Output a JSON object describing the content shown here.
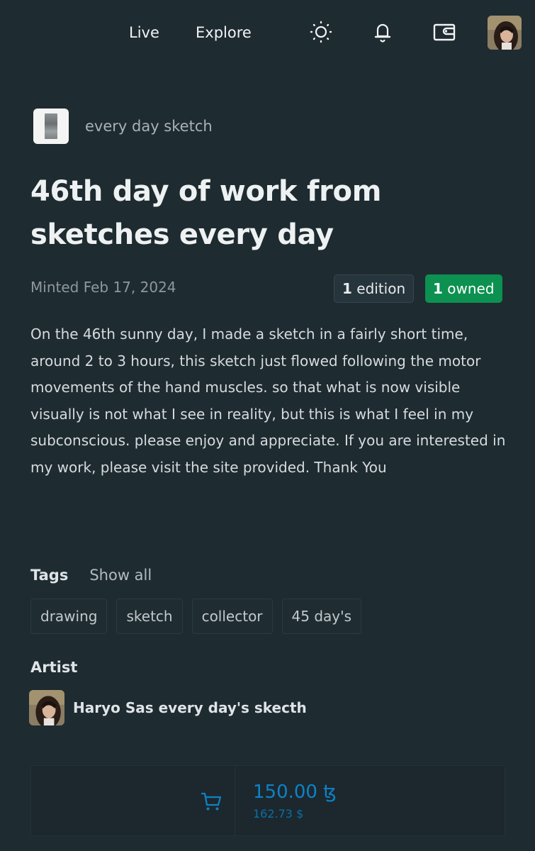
{
  "nav": {
    "live": "Live",
    "explore": "Explore",
    "icons": [
      "sun-icon",
      "bell-icon",
      "wallet-icon",
      "user-avatar"
    ]
  },
  "collection": {
    "name": "every day sketch"
  },
  "token": {
    "title": "46th day of work from sketches every day",
    "minted": "Minted Feb 17, 2024",
    "edition_count": "1",
    "edition_label": "edition",
    "owned_count": "1",
    "owned_label": "owned",
    "description": "On the 46th sunny day, I made a sketch in a fairly short time, around 2 to 3 hours, this sketch just flowed following the motor movements of the hand muscles. so that what is now visible visually is not what I see in reality, but this is what I feel in my subconscious. please enjoy and appreciate. If you are interested in my work, please visit the site provided. Thank You"
  },
  "tags": {
    "label": "Tags",
    "show_all": "Show all",
    "items": [
      "drawing",
      "sketch",
      "collector",
      "45 day's"
    ]
  },
  "artist": {
    "label": "Artist",
    "name": "Haryo Sas every day's skecth"
  },
  "buy": {
    "price": "150.00 ꜩ",
    "usd": "162.73 $",
    "icon": "cart-icon"
  },
  "colors": {
    "background": "#1e2b31",
    "owned_badge": "#0c9150",
    "price_accent": "#0e82c6"
  }
}
